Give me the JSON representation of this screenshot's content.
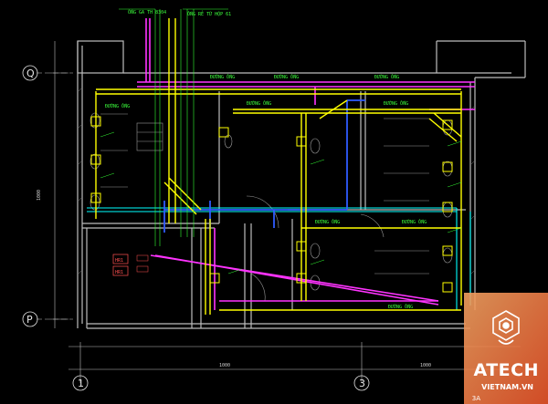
{
  "drawing": {
    "riser_labels": [
      "ỐNG GA TH 8304",
      "ỐNG RẺ TỪ HỘP 61"
    ],
    "grid_axes": {
      "horizontal": [
        "Q",
        "P"
      ],
      "vertical": [
        "1",
        "3"
      ]
    },
    "equipment_tags": [
      "HR1",
      "HR1"
    ],
    "dimension_labels": [
      "1000",
      "1000",
      "1000"
    ],
    "colors": {
      "background": "#000000",
      "walls": "#bdbdbd",
      "supply_duct": "#ffff00",
      "exhaust_duct": "#ff33ff",
      "chilled_pipe": "#00ffff",
      "drain_pipe": "#2f5cff",
      "annotations": "#33ff33"
    }
  },
  "logo": {
    "brand": "ATECH",
    "website": "VIETNAM.VN",
    "corner_mark": "3A",
    "brand_color": "#e8542a"
  }
}
